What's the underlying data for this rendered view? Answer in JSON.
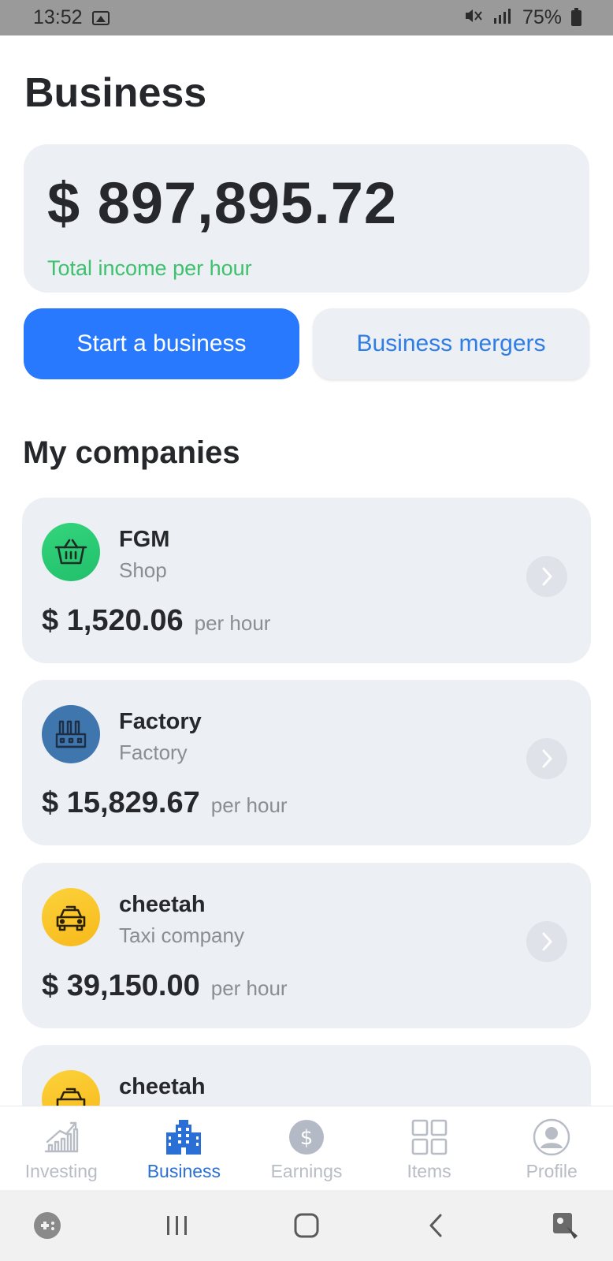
{
  "status_bar": {
    "time": "13:52",
    "battery": "75%",
    "icons": [
      "image-icon",
      "mute-icon",
      "signal-icon",
      "battery-icon"
    ]
  },
  "page": {
    "title": "Business"
  },
  "total_income": {
    "amount": "$ 897,895.72",
    "caption": "Total income per hour",
    "caption_color": "#3cc16d"
  },
  "actions": {
    "start_label": "Start a business",
    "mergers_label": "Business mergers",
    "accent_color": "#2979fe"
  },
  "companies_section": {
    "title": "My companies",
    "items": [
      {
        "name": "FGM",
        "type": "Shop",
        "amount": "$ 1,520.06",
        "unit": "per hour",
        "icon": "basket-icon"
      },
      {
        "name": "Factory",
        "type": "Factory",
        "amount": "$ 15,829.67",
        "unit": "per hour",
        "icon": "factory-icon"
      },
      {
        "name": "cheetah",
        "type": "Taxi company",
        "amount": "$ 39,150.00",
        "unit": "per hour",
        "icon": "taxi-icon"
      },
      {
        "name": "cheetah",
        "icon": "taxi-icon"
      }
    ]
  },
  "bottom_nav": {
    "active": "Business",
    "items": [
      {
        "label": "Investing",
        "icon": "chart-icon"
      },
      {
        "label": "Business",
        "icon": "building-icon"
      },
      {
        "label": "Earnings",
        "icon": "dollar-icon"
      },
      {
        "label": "Items",
        "icon": "grid-icon"
      },
      {
        "label": "Profile",
        "icon": "user-icon"
      }
    ]
  },
  "system_nav": {
    "icons": [
      "game-icon",
      "recent-apps-icon",
      "home-icon",
      "back-icon",
      "accessibility-icon"
    ]
  }
}
